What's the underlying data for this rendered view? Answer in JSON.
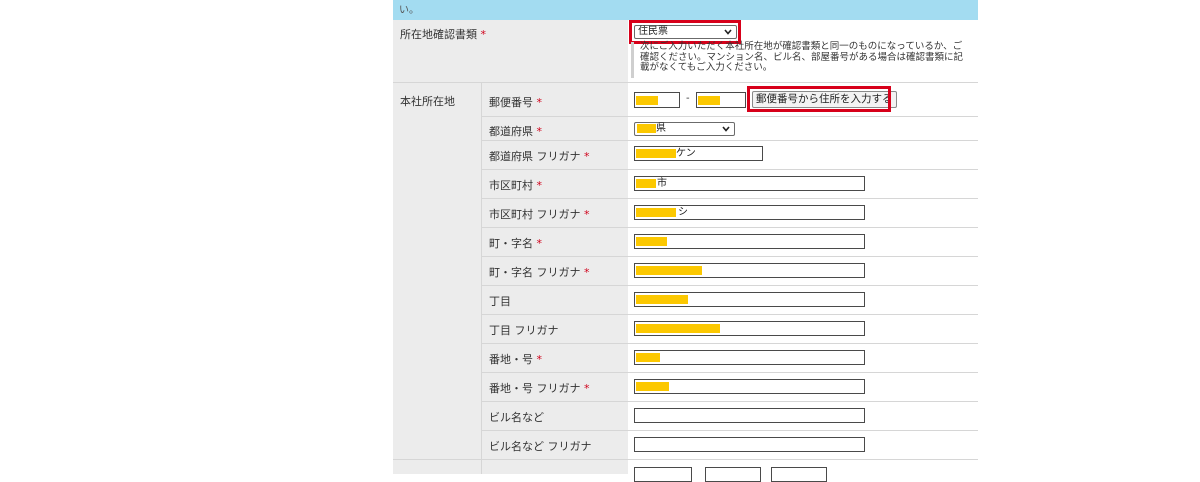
{
  "header": {
    "top_text": "い。"
  },
  "required_mark": "*",
  "doc_type": {
    "label": "所在地確認書類",
    "selected": "住民票",
    "note": "次にご入力いただく本社所在地が確認書類と同一のものになっているか、ご確認ください。マンション名、ビル名、部屋番号がある場合は確認書類に記載がなくてもご入力ください。"
  },
  "address": {
    "section_label": "本社所在地",
    "postal": {
      "label": "郵便番号",
      "separator": "-",
      "lookup_button": "郵便番号から住所を入力する"
    },
    "prefecture": {
      "label": "都道府県",
      "selected_suffix": "県"
    },
    "prefecture_kana": {
      "label": "都道府県 フリガナ",
      "value_suffix": "ケン"
    },
    "city": {
      "label": "市区町村",
      "value_suffix": "市"
    },
    "city_kana": {
      "label": "市区町村 フリガナ",
      "value_suffix": "シ"
    },
    "town": {
      "label": "町・字名"
    },
    "town_kana": {
      "label": "町・字名 フリガナ"
    },
    "chome": {
      "label": "丁目"
    },
    "chome_kana": {
      "label": "丁目 フリガナ"
    },
    "banchi": {
      "label": "番地・号"
    },
    "banchi_kana": {
      "label": "番地・号 フリガナ"
    },
    "building": {
      "label": "ビル名など"
    },
    "building_kana": {
      "label": "ビル名など フリガナ"
    }
  },
  "colors": {
    "banner": "#a3dcf1",
    "highlight": "#fcc800",
    "annotation": "#d7001a",
    "required": "#d0021b"
  }
}
